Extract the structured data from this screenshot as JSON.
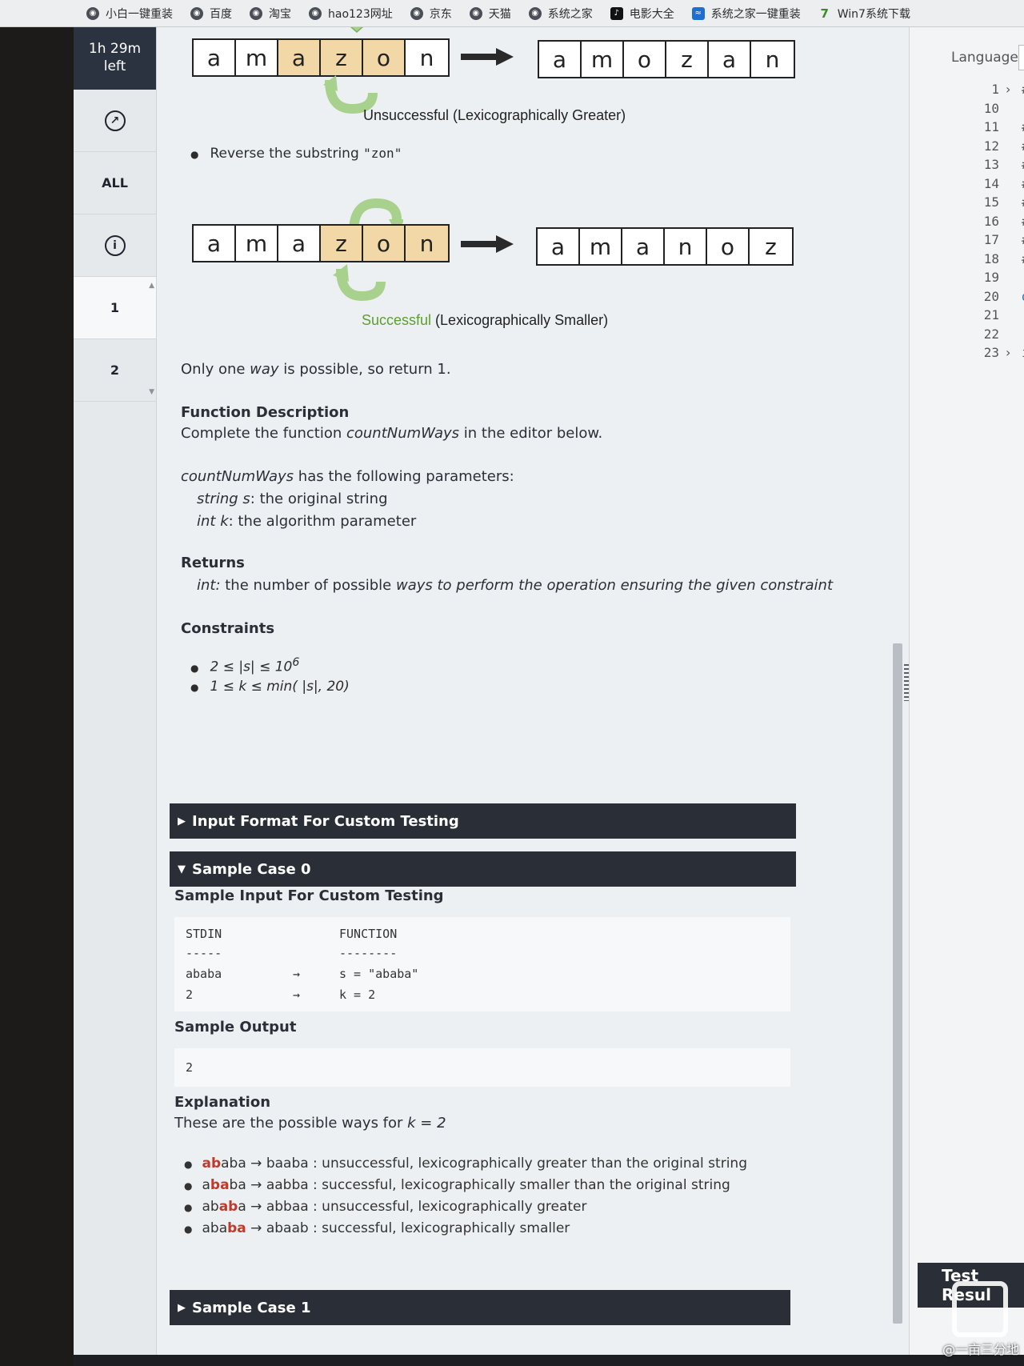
{
  "bookmarks": [
    {
      "label": "小白一键重装",
      "icon": "globe-icon"
    },
    {
      "label": "百度",
      "icon": "globe-icon"
    },
    {
      "label": "淘宝",
      "icon": "globe-icon"
    },
    {
      "label": "hao123网址",
      "icon": "globe-icon"
    },
    {
      "label": "京东",
      "icon": "globe-icon"
    },
    {
      "label": "天猫",
      "icon": "globe-icon"
    },
    {
      "label": "系统之家",
      "icon": "globe-icon"
    },
    {
      "label": "电影大全",
      "icon": "tiktok-icon"
    },
    {
      "label": "系统之家一键重装",
      "icon": "xitong-icon"
    },
    {
      "label": "Win7系统下载",
      "icon": "win7-icon"
    }
  ],
  "rail": {
    "timer_line1": "1h 29m",
    "timer_line2": "left",
    "all_label": "ALL",
    "q1": "1",
    "q2": "2"
  },
  "diagram": {
    "row1_left": [
      "a",
      "m",
      "a",
      "z",
      "o",
      "n"
    ],
    "row1_right": [
      "a",
      "m",
      "o",
      "z",
      "a",
      "n"
    ],
    "row1_caption": "Unsuccessful (Lexicographically Greater)",
    "bullet_prefix": "Reverse the substring ",
    "bullet_code": "\"zon\"",
    "row2_left": [
      "a",
      "m",
      "a",
      "z",
      "o",
      "n"
    ],
    "row2_right": [
      "a",
      "m",
      "a",
      "n",
      "o",
      "z"
    ],
    "row2_caption_ok": "Successful",
    "row2_caption_rest": " (Lexicographically Smaller)"
  },
  "text": {
    "only_one_a": "Only one ",
    "only_one_way": "way",
    "only_one_b": " is possible, so return 1.",
    "func_desc_title": "Function Description",
    "func_desc_a": "Complete the function ",
    "func_desc_fn": "countNumWays",
    "func_desc_b": " in the editor below.",
    "params_fn": "countNumWays",
    "params_rest": " has the following parameters:",
    "param1_type": "string s",
    "param1_desc": ": the original string",
    "param2_type": "int k",
    "param2_desc": ": the algorithm parameter",
    "returns_title": "Returns",
    "returns_type": "int:",
    "returns_a": " the number of possible ",
    "returns_b": "ways to perform the operation ensuring the given constraint",
    "constraints_title": "Constraints",
    "constraint1_base": "2 ≤ |s| ≤ 10",
    "constraint1_exp": "6",
    "constraint2": "1 ≤ k ≤ min( |s|, 20)"
  },
  "sections": {
    "input_format": "Input Format For Custom Testing",
    "sample0": "Sample Case 0",
    "sample1": "Sample Case 1"
  },
  "sample0": {
    "input_title": "Sample Input For Custom Testing",
    "stdin_header": "STDIN",
    "function_header": "FUNCTION",
    "stdin_dash": "-----",
    "function_dash": "--------",
    "row1_stdin": "ababa",
    "row1_arrow": "→",
    "row1_fn": "s = \"ababa\"",
    "row2_stdin": "2",
    "row2_arrow": "→",
    "row2_fn": "k = 2",
    "output_title": "Sample Output",
    "output_value": "2",
    "explanation_title": "Explanation",
    "explanation_a": "These are the possible ways for ",
    "explanation_k": "k = 2",
    "ways": [
      {
        "pre": "",
        "red": "ab",
        "post": "aba",
        "result": " → baaba : unsuccessful, lexicographically greater than the original string"
      },
      {
        "pre": "a",
        "red": "ba",
        "post": "ba",
        "result": " → aabba : successful,  lexicographically smaller than the original string"
      },
      {
        "pre": "ab",
        "red": "ab",
        "post": "a",
        "result": " → abbaa : unsuccessful, lexicographically greater"
      },
      {
        "pre": "aba",
        "red": "ba",
        "post": "",
        "result": " → abaab : successful, lexicographically smaller"
      }
    ]
  },
  "editor": {
    "language_label": "Language",
    "lines": [
      {
        "n": "1",
        "code": "#!/",
        "fold": true
      },
      {
        "n": "10",
        "code": ""
      },
      {
        "n": "11",
        "code": "#"
      },
      {
        "n": "12",
        "code": "# C"
      },
      {
        "n": "13",
        "code": "#"
      },
      {
        "n": "14",
        "code": "# T"
      },
      {
        "n": "15",
        "code": "# T"
      },
      {
        "n": "16",
        "code": "#"
      },
      {
        "n": "17",
        "code": "#"
      },
      {
        "n": "18",
        "code": "#"
      },
      {
        "n": "19",
        "code": ""
      },
      {
        "n": "20",
        "code": "def",
        "kw": true
      },
      {
        "n": "21",
        "code": ""
      },
      {
        "n": "22",
        "code": ""
      },
      {
        "n": "23",
        "code": "if",
        "fold": true,
        "kw": true
      }
    ],
    "test_results_label": "Test Resul"
  },
  "watermark": "@一亩三分地"
}
